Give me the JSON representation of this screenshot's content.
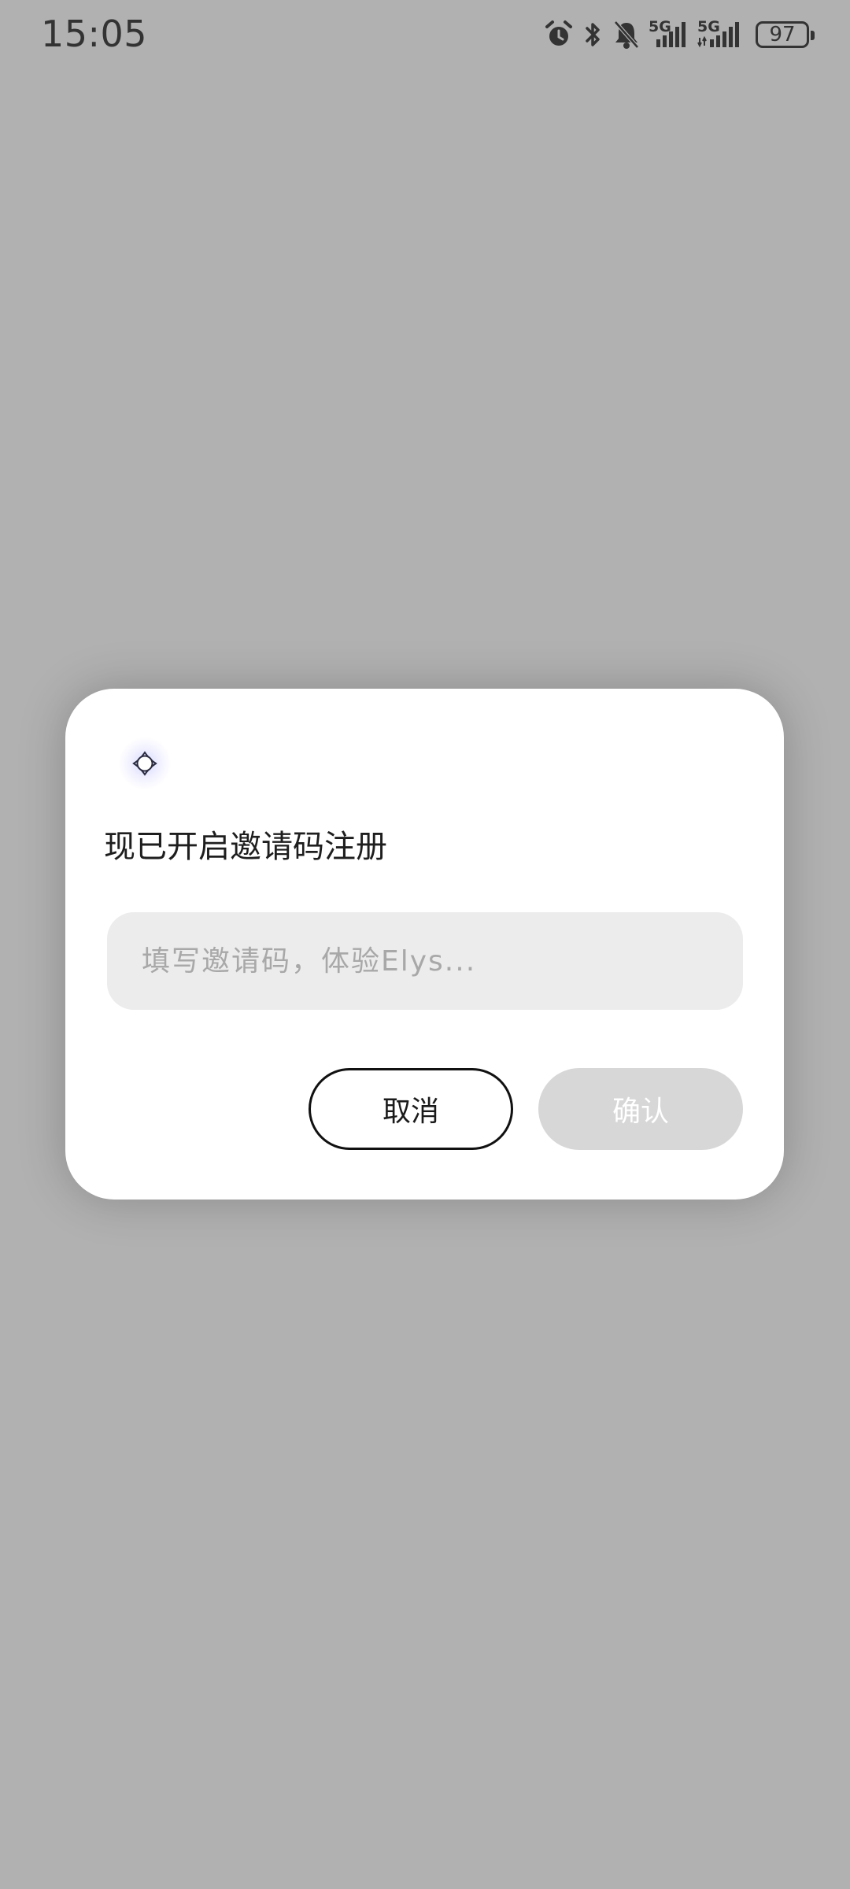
{
  "status_bar": {
    "time": "15:05",
    "network_1": "5G",
    "network_2": "5G",
    "battery": "97",
    "icons": [
      "alarm-icon",
      "bluetooth-icon",
      "bell-muted-icon",
      "signal-icon",
      "signal-icon",
      "battery-icon"
    ]
  },
  "dialog": {
    "logo_icon": "app-logo-icon",
    "title": "现已开启邀请码注册",
    "input": {
      "value": "",
      "placeholder": "填写邀请码，体验Elys..."
    },
    "cancel_label": "取消",
    "confirm_label": "确认"
  },
  "colors": {
    "overlay": "#b1b1b1",
    "dialog_bg": "#ffffff",
    "input_bg": "#ececec",
    "confirm_disabled": "#d7d7d7",
    "text_primary": "#1e1e1e"
  }
}
